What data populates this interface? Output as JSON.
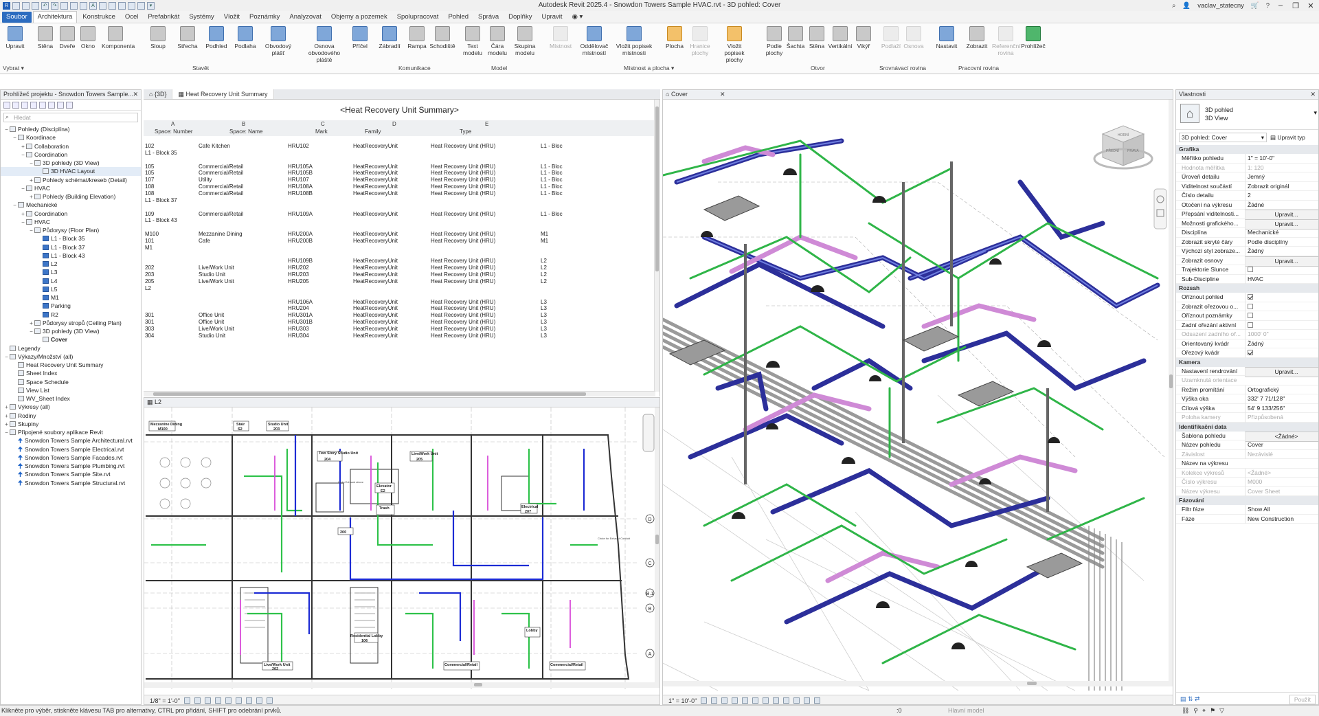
{
  "app": {
    "title": "Autodesk Revit 2025.4 - Snowdon Towers Sample HVAC.rvt - 3D pohled: Cover",
    "user": "vaclav_statecny"
  },
  "ribbon": {
    "tabs": [
      "Soubor",
      "Architektura",
      "Konstrukce",
      "Ocel",
      "Prefabrikát",
      "Systémy",
      "Vložit",
      "Poznámky",
      "Analyzovat",
      "Objemy a pozemek",
      "Spolupracovat",
      "Pohled",
      "Správa",
      "Doplňky",
      "Upravit"
    ],
    "select_label": "Vybrat",
    "buttons": [
      "Upravit",
      "Stěna",
      "Dveře",
      "Okno",
      "Komponenta",
      "Sloup",
      "Střecha",
      "Podhled",
      "Podlaha",
      "Obvodový plášť",
      "Osnova obvodového pláště",
      "Příčel",
      "Zábradlí",
      "Rampa",
      "Schodiště",
      "Text modelu",
      "Čára modelu",
      "Skupina modelu",
      "Místnost",
      "Oddělovač místností",
      "Vložit popisek místnosti",
      "Plocha",
      "Hranice plochy",
      "Vložit popisek plochy",
      "Podle plochy",
      "Šachta",
      "Stěna",
      "Vertikální",
      "Vikýř",
      "Podlaží",
      "Osnova",
      "Nastavit",
      "Zobrazit",
      "Referenční rovina",
      "Prohlížeč"
    ],
    "panels": [
      "Stavět",
      "Komunikace",
      "Model",
      "Místnost a plocha",
      "Otvor",
      "Srovnávací rovina",
      "Pracovní rovina"
    ]
  },
  "browser": {
    "title": "Prohlížeč projektu - Snowdon Towers Sample...",
    "search_placeholder": "Hledat",
    "items": [
      {
        "t": "Pohledy (Disciplína)",
        "l": 0,
        "e": "-"
      },
      {
        "t": "Koordinace",
        "l": 1,
        "e": "-"
      },
      {
        "t": "Collaboration",
        "l": 2,
        "e": "+"
      },
      {
        "t": "Coordination",
        "l": 2,
        "e": "-"
      },
      {
        "t": "3D pohledy (3D View)",
        "l": 3,
        "e": "-"
      },
      {
        "t": "3D HVAC Layout",
        "l": 4,
        "e": ""
      },
      {
        "t": "Pohledy schémat/kreseb (Detail)",
        "l": 3,
        "e": "+"
      },
      {
        "t": "HVAC",
        "l": 2,
        "e": "-"
      },
      {
        "t": "Pohledy (Building Elevation)",
        "l": 3,
        "e": "+"
      },
      {
        "t": "Mechanické",
        "l": 1,
        "e": "-"
      },
      {
        "t": "Coordination",
        "l": 2,
        "e": "+"
      },
      {
        "t": "HVAC",
        "l": 2,
        "e": "-"
      },
      {
        "t": "Půdorysy (Floor Plan)",
        "l": 3,
        "e": "-"
      },
      {
        "t": "L1 - Block 35",
        "l": 4,
        "e": "",
        "p": true
      },
      {
        "t": "L1 - Block 37",
        "l": 4,
        "e": "",
        "p": true
      },
      {
        "t": "L1 - Block 43",
        "l": 4,
        "e": "",
        "p": true
      },
      {
        "t": "L2",
        "l": 4,
        "e": "",
        "p": true
      },
      {
        "t": "L3",
        "l": 4,
        "e": "",
        "p": true
      },
      {
        "t": "L4",
        "l": 4,
        "e": "",
        "p": true
      },
      {
        "t": "L5",
        "l": 4,
        "e": "",
        "p": true
      },
      {
        "t": "M1",
        "l": 4,
        "e": "",
        "p": true
      },
      {
        "t": "Parking",
        "l": 4,
        "e": "",
        "p": true
      },
      {
        "t": "R2",
        "l": 4,
        "e": "",
        "p": true
      },
      {
        "t": "Půdorysy stropů (Ceiling Plan)",
        "l": 3,
        "e": "+"
      },
      {
        "t": "3D pohledy (3D View)",
        "l": 3,
        "e": "-"
      },
      {
        "t": "Cover",
        "l": 4,
        "e": "",
        "b": true
      },
      {
        "t": "Legendy",
        "l": 0,
        "e": ""
      },
      {
        "t": "Výkazy/Množství (all)",
        "l": 0,
        "e": "-"
      },
      {
        "t": "Heat Recovery Unit Summary",
        "l": 1,
        "e": ""
      },
      {
        "t": "Sheet Index",
        "l": 1,
        "e": ""
      },
      {
        "t": "Space Schedule",
        "l": 1,
        "e": ""
      },
      {
        "t": "View List",
        "l": 1,
        "e": ""
      },
      {
        "t": "WV_Sheet Index",
        "l": 1,
        "e": ""
      },
      {
        "t": "Výkresy (all)",
        "l": 0,
        "e": "+"
      },
      {
        "t": "Rodiny",
        "l": 0,
        "e": "+"
      },
      {
        "t": "Skupiny",
        "l": 0,
        "e": "+"
      },
      {
        "t": "Připojené soubory aplikace Revit",
        "l": 0,
        "e": "-"
      },
      {
        "t": "Snowdon Towers Sample Architectural.rvt",
        "l": 1,
        "e": "",
        "k": true
      },
      {
        "t": "Snowdon Towers Sample Electrical.rvt",
        "l": 1,
        "e": "",
        "k": true
      },
      {
        "t": "Snowdon Towers Sample Facades.rvt",
        "l": 1,
        "e": "",
        "k": true
      },
      {
        "t": "Snowdon Towers Sample Plumbing.rvt",
        "l": 1,
        "e": "",
        "k": true
      },
      {
        "t": "Snowdon Towers Sample Site.rvt",
        "l": 1,
        "e": "",
        "k": true
      },
      {
        "t": "Snowdon Towers Sample Structural.rvt",
        "l": 1,
        "e": "",
        "k": true
      }
    ]
  },
  "doc_tabs": {
    "tab1": "{3D}",
    "tab2": "Heat Recovery Unit Summary"
  },
  "schedule": {
    "title": "<Heat Recovery Unit Summary>",
    "col_letters": [
      "A",
      "B",
      "C",
      "D",
      "E"
    ],
    "columns": [
      "Space: Number",
      "Space: Name",
      "Mark",
      "Family",
      "Type"
    ],
    "rows": [
      [
        "102",
        "Cafe Kitchen",
        "HRU102",
        "HeatRecoveryUnit",
        "Heat Recovery Unit (HRU)",
        "L1 - Bloc"
      ],
      [
        "L1 - Block 35",
        "",
        "",
        "",
        "",
        ""
      ],
      [
        "",
        "",
        "",
        "",
        "",
        ""
      ],
      [
        "105",
        "Commercial/Retail",
        "HRU105A",
        "HeatRecoveryUnit",
        "Heat Recovery Unit (HRU)",
        "L1 - Bloc"
      ],
      [
        "105",
        "Commercial/Retail",
        "HRU105B",
        "HeatRecoveryUnit",
        "Heat Recovery Unit (HRU)",
        "L1 - Bloc"
      ],
      [
        "107",
        "Utility",
        "HRU107",
        "HeatRecoveryUnit",
        "Heat Recovery Unit (HRU)",
        "L1 - Bloc"
      ],
      [
        "108",
        "Commercial/Retail",
        "HRU108A",
        "HeatRecoveryUnit",
        "Heat Recovery Unit (HRU)",
        "L1 - Bloc"
      ],
      [
        "108",
        "Commercial/Retail",
        "HRU108B",
        "HeatRecoveryUnit",
        "Heat Recovery Unit (HRU)",
        "L1 - Bloc"
      ],
      [
        "L1 - Block 37",
        "",
        "",
        "",
        "",
        ""
      ],
      [
        "",
        "",
        "",
        "",
        "",
        ""
      ],
      [
        "109",
        "Commercial/Retail",
        "HRU109A",
        "HeatRecoveryUnit",
        "Heat Recovery Unit (HRU)",
        "L1 - Bloc"
      ],
      [
        "L1 - Block 43",
        "",
        "",
        "",
        "",
        ""
      ],
      [
        "",
        "",
        "",
        "",
        "",
        ""
      ],
      [
        "M100",
        "Mezzanine Dining",
        "HRU200A",
        "HeatRecoveryUnit",
        "Heat Recovery Unit (HRU)",
        "M1"
      ],
      [
        "101",
        "Cafe",
        "HRU200B",
        "HeatRecoveryUnit",
        "Heat Recovery Unit (HRU)",
        "M1"
      ],
      [
        "M1",
        "",
        "",
        "",
        "",
        ""
      ],
      [
        "",
        "",
        "",
        "",
        "",
        ""
      ],
      [
        "",
        "",
        "HRU109B",
        "HeatRecoveryUnit",
        "Heat Recovery Unit (HRU)",
        "L2"
      ],
      [
        "202",
        "Live/Work Unit",
        "HRU202",
        "HeatRecoveryUnit",
        "Heat Recovery Unit (HRU)",
        "L2"
      ],
      [
        "203",
        "Studio Unit",
        "HRU203",
        "HeatRecoveryUnit",
        "Heat Recovery Unit (HRU)",
        "L2"
      ],
      [
        "205",
        "Live/Work Unit",
        "HRU205",
        "HeatRecoveryUnit",
        "Heat Recovery Unit (HRU)",
        "L2"
      ],
      [
        "L2",
        "",
        "",
        "",
        "",
        ""
      ],
      [
        "",
        "",
        "",
        "",
        "",
        ""
      ],
      [
        "",
        "",
        "HRU106A",
        "HeatRecoveryUnit",
        "Heat Recovery Unit (HRU)",
        "L3"
      ],
      [
        "",
        "",
        "HRU204",
        "HeatRecoveryUnit",
        "Heat Recovery Unit (HRU)",
        "L3"
      ],
      [
        "301",
        "Office Unit",
        "HRU301A",
        "HeatRecoveryUnit",
        "Heat Recovery Unit (HRU)",
        "L3"
      ],
      [
        "301",
        "Office Unit",
        "HRU301B",
        "HeatRecoveryUnit",
        "Heat Recovery Unit (HRU)",
        "L3"
      ],
      [
        "303",
        "Live/Work Unit",
        "HRU303",
        "HeatRecoveryUnit",
        "Heat Recovery Unit (HRU)",
        "L3"
      ],
      [
        "304",
        "Studio Unit",
        "HRU304",
        "HeatRecoveryUnit",
        "Heat Recovery Unit (HRU)",
        "L3"
      ]
    ]
  },
  "plan": {
    "tab": "L2",
    "scale": "1/8\" = 1'-0\"",
    "rooms": [
      "Mezzanine Dining",
      "M100",
      "Stair",
      "S2",
      "Studio Unit",
      "203",
      "Two Story Studio Unit",
      "204",
      "Live/Work Unit",
      "205",
      "Elevator",
      "E2",
      "Trash",
      "Electrical",
      "207",
      "200",
      "Residential Lobby",
      "106",
      "Lobby",
      "Live/Work Unit",
      "202",
      "Commercial/Retail",
      "Commercial/Retail",
      "Chute for Exhaust Conduit",
      "Up to Exhaust above"
    ],
    "grid_labels": [
      "E",
      "D",
      "C",
      "B.1",
      "B",
      "A"
    ]
  },
  "view3d": {
    "tab": "Cover",
    "scale": "1\" = 10'-0\"",
    "cube_labels": [
      "HORNÍ",
      "PŘEDNÍ",
      "PRAVÁ"
    ]
  },
  "properties": {
    "title": "Vlastnosti",
    "type_name": "3D pohled",
    "type_sub": "3D View",
    "selector": "3D pohled: Cover",
    "edit_type": "Upravit typ",
    "sections": [
      {
        "name": "Grafika",
        "rows": [
          [
            "Měřítko pohledu",
            "1\" = 10'-0\"",
            0
          ],
          [
            "Hodnota měřítka",
            "1:   120",
            1
          ],
          [
            "Úroveň detailu",
            "Jemný",
            0
          ],
          [
            "Viditelnost součástí",
            "Zobrazit originál",
            0
          ],
          [
            "Číslo detailu",
            "2",
            0
          ],
          [
            "Otočení na výkresu",
            "Žádné",
            0
          ],
          [
            "Přepsání viditelnosti...",
            "Upravit...",
            2
          ],
          [
            "Možnosti grafického...",
            "Upravit...",
            2
          ],
          [
            "Disciplína",
            "Mechanické",
            0
          ],
          [
            "Zobrazit skryté čáry",
            "Podle disciplíny",
            0
          ],
          [
            "Výchozí styl zobraze...",
            "Žádný",
            0
          ],
          [
            "Zobrazit osnovy",
            "Upravit...",
            2
          ],
          [
            "Trajektorie Slunce",
            "",
            3
          ],
          [
            "Sub-Discipline",
            "HVAC",
            0
          ]
        ]
      },
      {
        "name": "Rozsah",
        "rows": [
          [
            "Oříznout pohled",
            "",
            4
          ],
          [
            "Zobrazit ořezovou o...",
            "",
            3
          ],
          [
            "Oříznout poznámky",
            "",
            3
          ],
          [
            "Zadní ořezání aktivní",
            "",
            3
          ],
          [
            "Odsazení zadního oř...",
            "1000' 0\"",
            1
          ],
          [
            "Orientovaný kvádr",
            "Žádný",
            0
          ],
          [
            "Ořezový kvádr",
            "",
            4
          ]
        ]
      },
      {
        "name": "Kamera",
        "rows": [
          [
            "Nastavení rendrování",
            "Upravit...",
            2
          ],
          [
            "Uzamknutá orientace",
            "",
            1
          ],
          [
            "Režim promítání",
            "Ortografický",
            0
          ],
          [
            "Výška oka",
            "332' 7 71/128\"",
            0
          ],
          [
            "Cílová výška",
            "54' 9 133/256\"",
            0
          ],
          [
            "Poloha kamery",
            "Přizpůsobená",
            1
          ]
        ]
      },
      {
        "name": "Identifikační data",
        "rows": [
          [
            "Šablona pohledu",
            "<Žádné>",
            2
          ],
          [
            "Název pohledu",
            "Cover",
            0
          ],
          [
            "Závislost",
            "Nezávislé",
            1
          ],
          [
            "Název na výkresu",
            "",
            0
          ],
          [
            "Kolekce výkresů",
            "<Žádné>",
            1
          ],
          [
            "Číslo výkresu",
            "M000",
            1
          ],
          [
            "Název výkresu",
            "Cover Sheet",
            1
          ]
        ]
      },
      {
        "name": "Fázování",
        "rows": [
          [
            "Filtr fáze",
            "Show All",
            0
          ],
          [
            "Fáze",
            "New Construction",
            0
          ]
        ]
      }
    ],
    "apply": "Použít"
  },
  "status": {
    "text": "Klikněte pro výběr, stiskněte klávesu TAB pro alternativy, CTRL pro přidání, SHIFT pro odebrání prvků.",
    "model": "Hlavní model",
    "count": ":0"
  }
}
